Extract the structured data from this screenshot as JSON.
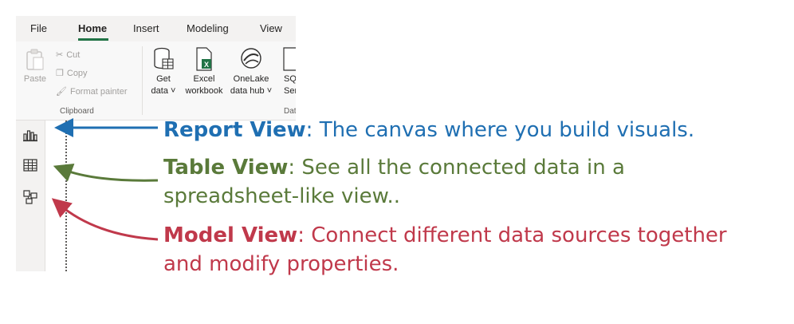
{
  "tabs": [
    "File",
    "Home",
    "Insert",
    "Modeling",
    "View"
  ],
  "clipboard": {
    "paste": "Paste",
    "cut": "Cut",
    "copy": "Copy",
    "format_painter": "Format painter",
    "group_label": "Clipboard"
  },
  "data_group": {
    "get_data": [
      "Get",
      "data"
    ],
    "excel": [
      "Excel",
      "workbook"
    ],
    "onelake": [
      "OneLake",
      "data hub"
    ],
    "sql": [
      "SQ",
      "Serv"
    ],
    "group_label": "Dat"
  },
  "annotations": {
    "report": {
      "title": "Report View",
      "text": ": The canvas where you build visuals.",
      "color": "#1f6fb2"
    },
    "table": {
      "title": "Table View",
      "text": ": See all the connected data in a",
      "text2": "spreadsheet-like view..",
      "color": "#5a7a3a"
    },
    "model": {
      "title": "Model View",
      "text": ": Connect different data sources together",
      "text2": "and modify properties.",
      "color": "#c0394b"
    }
  }
}
